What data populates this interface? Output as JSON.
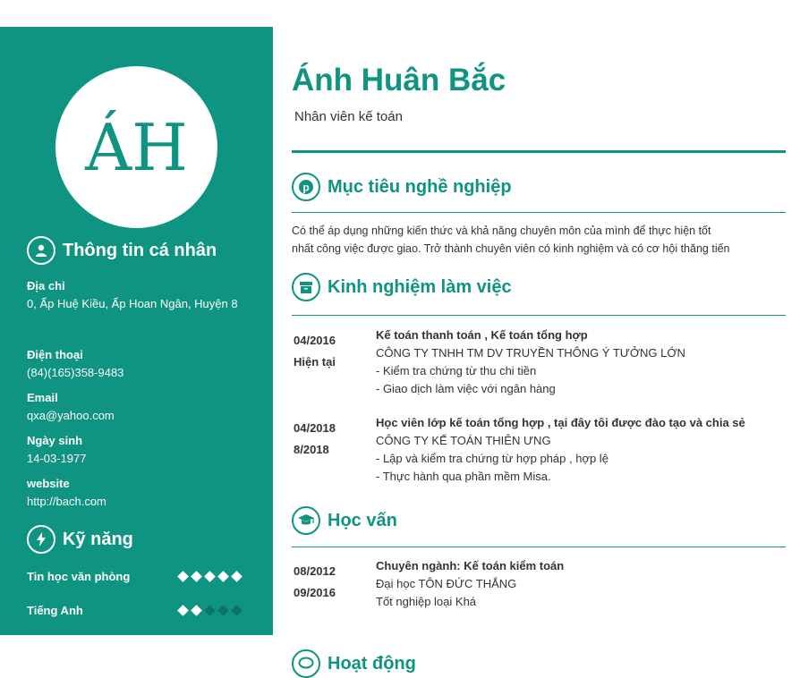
{
  "sidebar": {
    "initials": "ÁH",
    "personal_title": "Thông tin cá nhân",
    "fields": [
      {
        "label": "Địa chỉ",
        "value": "0, Ấp Huệ Kiều, Ấp Hoan Ngân, Huyện 8"
      },
      {
        "label": "Điện thoại",
        "value": "(84)(165)358-9483"
      },
      {
        "label": "Email",
        "value": "qxa@yahoo.com"
      },
      {
        "label": "Ngày sinh",
        "value": "14-03-1977"
      },
      {
        "label": "website",
        "value": "http://bach.com"
      }
    ],
    "skills_title": "Kỹ năng",
    "skills": [
      {
        "name": "Tin học văn phòng",
        "level": 5,
        "max": 5
      },
      {
        "name": "Tiếng Anh",
        "level": 2,
        "max": 5
      }
    ]
  },
  "header": {
    "name": "Ánh Huân Bắc",
    "role": "Nhân viên kế toán"
  },
  "objective": {
    "title": "Mục tiêu nghề nghiệp",
    "line1": "Có thể áp dụng những kiến thức và khả năng chuyên môn của mình để thực hiện tốt",
    "line2": "nhất công việc được giao. Trở thành chuyên viên có kinh nghiệm và có cơ hội thăng tiến"
  },
  "experience": {
    "title": "Kinh nghiệm làm việc",
    "items": [
      {
        "start": "04/2016",
        "end": "Hiện tại",
        "position": "Kế toán thanh toán , Kế toán tổng hợp",
        "company": "CÔNG TY TNHH TM DV TRUYỀN THÔNG Ý TƯỞNG LỚN",
        "d1": "- Kiểm tra chứng từ thu chi tiền",
        "d2": "- Giao dịch làm việc với ngân hàng"
      },
      {
        "start": "04/2018",
        "end": "8/2018",
        "position": "Học viên  lớp  kế toán tổng hợp , tại đây tôi được đào tạo và chia sẻ",
        "company": "CÔNG TY KẾ TOÁN THIÊN ƯNG",
        "d1": "- Lập và kiểm tra chứng từ hợp pháp , hợp lệ",
        "d2": "- Thực hành qua phần mềm Misa."
      }
    ]
  },
  "education": {
    "title": "Học vấn",
    "start": "08/2012",
    "end": "09/2016",
    "major": "Chuyên ngành: Kế toán kiểm toán",
    "school": "Đại học TÔN ĐỨC THẮNG",
    "grade": "Tốt nghiệp loại Khá"
  },
  "activities": {
    "title": "Hoạt động"
  },
  "colors": {
    "accent": "#0e9480"
  }
}
